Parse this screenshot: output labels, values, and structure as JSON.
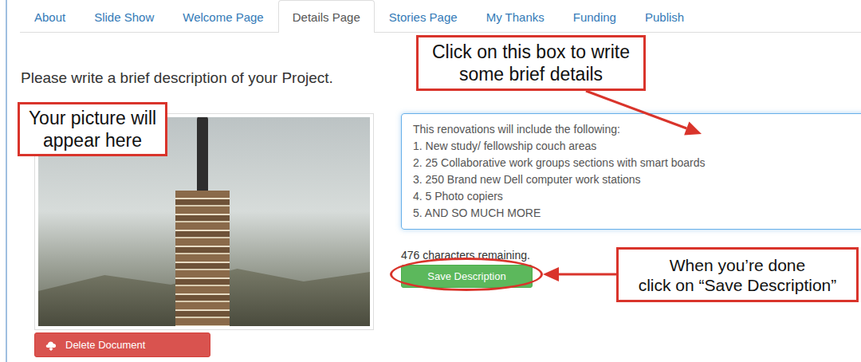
{
  "tabs": [
    {
      "label": "About",
      "selected": false
    },
    {
      "label": "Slide Show",
      "selected": false
    },
    {
      "label": "Welcome Page",
      "selected": false
    },
    {
      "label": "Details Page",
      "selected": true
    },
    {
      "label": "Stories Page",
      "selected": false
    },
    {
      "label": "My Thanks",
      "selected": false
    },
    {
      "label": "Funding",
      "selected": false
    },
    {
      "label": "Publish",
      "selected": false
    }
  ],
  "heading": "Please write a brief description of your Project.",
  "description": {
    "lines": [
      "This renovations will include the following:",
      "1. New study/ fellowship couch areas",
      "2. 25 Collaborative work groups sections with smart boards",
      "3. 250 Brand new Dell computer work stations",
      "4. 5 Photo copiers",
      "5. AND SO MUCH MORE"
    ]
  },
  "characters_remaining": "476 characters remaining.",
  "save_button": "Save Description",
  "delete_button": "Delete Document",
  "callouts": {
    "details": [
      "Click on this box to write",
      "some brief details"
    ],
    "picture": [
      "Your picture will",
      "appear here"
    ],
    "save": [
      "When you’re done",
      "click on “Save Description”"
    ]
  }
}
